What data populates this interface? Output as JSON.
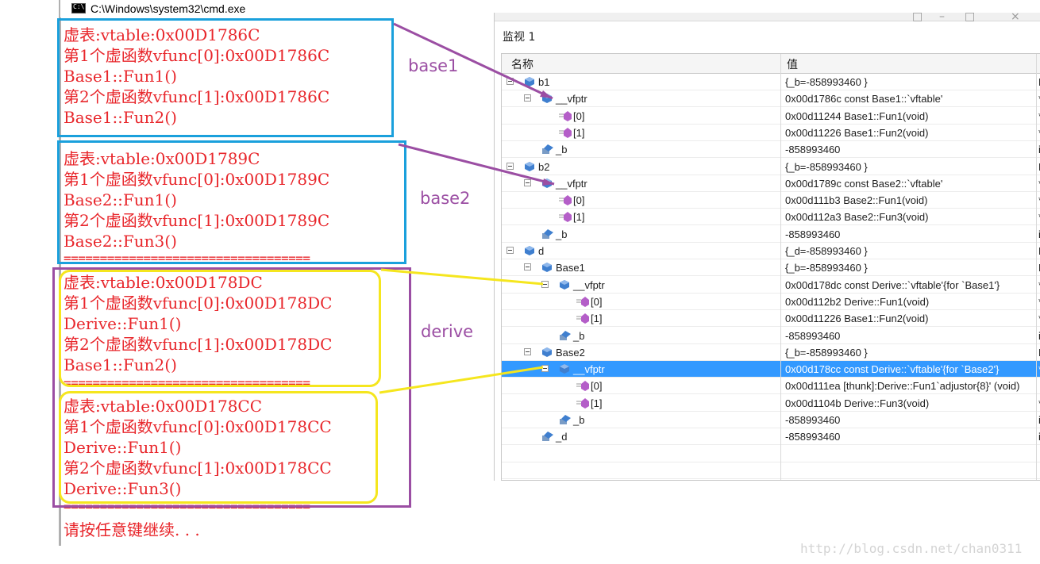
{
  "cmd": {
    "title": "C:\\Windows\\system32\\cmd.exe",
    "lines": [
      "虚表:vtable:0x00D1786C",
      "第1个虚函数vfunc[0]:0x00D1786C",
      "Base1::Fun1()",
      "第2个虚函数vfunc[1]:0x00D1786C",
      "Base1::Fun2()",
      "虚表:vtable:0x00D1789C",
      "第1个虚函数vfunc[0]:0x00D1789C",
      "Base2::Fun1()",
      "第2个虚函数vfunc[1]:0x00D1789C",
      "Base2::Fun3()",
      "虚表:vtable:0x00D178DC",
      "第1个虚函数vfunc[0]:0x00D178DC",
      "Derive::Fun1()",
      "第2个虚函数vfunc[1]:0x00D178DC",
      "Base1::Fun2()",
      "虚表:vtable:0x00D178CC",
      "第1个虚函数vfunc[0]:0x00D178CC",
      "Derive::Fun1()",
      "第2个虚函数vfunc[1]:0x00D178CC",
      "Derive::Fun3()"
    ],
    "separator1": "==================================",
    "separator2": "==================================",
    "separator3": "==================================",
    "prompt": "请按任意键继续. . ."
  },
  "annotations": {
    "base1": "base1",
    "base2": "base2",
    "derive": "derive",
    "colors": {
      "blue": "#1aa0dc",
      "purple": "#9b4ea3",
      "yellow": "#f5e61e"
    }
  },
  "watch": {
    "title": "监视 1",
    "col_name": "名称",
    "col_value": "值",
    "rows": [
      {
        "name": "b1",
        "value": "{_b=-858993460 }",
        "type": "B",
        "icon": "object-icon"
      },
      {
        "name": "__vfptr",
        "value": "0x00d1786c const Base1::`vftable'",
        "type": "*",
        "icon": "object-icon"
      },
      {
        "name": "[0]",
        "value": "0x00d11244 Base1::Fun1(void)",
        "type": "*",
        "icon": "method-icon"
      },
      {
        "name": "[1]",
        "value": "0x00d11226 Base1::Fun2(void)",
        "type": "*",
        "icon": "method-icon"
      },
      {
        "name": "_b",
        "value": "-858993460",
        "type": "i",
        "icon": "field-icon"
      },
      {
        "name": "b2",
        "value": "{_b=-858993460 }",
        "type": "B",
        "icon": "object-icon"
      },
      {
        "name": "__vfptr",
        "value": "0x00d1789c const Base2::`vftable'",
        "type": "*",
        "icon": "object-icon"
      },
      {
        "name": "[0]",
        "value": "0x00d111b3 Base2::Fun1(void)",
        "type": "*",
        "icon": "method-icon"
      },
      {
        "name": "[1]",
        "value": "0x00d112a3 Base2::Fun3(void)",
        "type": "*",
        "icon": "method-icon"
      },
      {
        "name": "_b",
        "value": "-858993460",
        "type": "i",
        "icon": "field-icon"
      },
      {
        "name": "d",
        "value": "{_d=-858993460 }",
        "type": "D",
        "icon": "object-icon"
      },
      {
        "name": "Base1",
        "value": "{_b=-858993460 }",
        "type": "B",
        "icon": "object-icon"
      },
      {
        "name": "__vfptr",
        "value": "0x00d178dc const Derive::`vftable'{for `Base1'}",
        "type": "*",
        "icon": "object-icon"
      },
      {
        "name": "[0]",
        "value": "0x00d112b2 Derive::Fun1(void)",
        "type": "*",
        "icon": "method-icon"
      },
      {
        "name": "[1]",
        "value": "0x00d11226 Base1::Fun2(void)",
        "type": "*",
        "icon": "method-icon"
      },
      {
        "name": "_b",
        "value": "-858993460",
        "type": "i",
        "icon": "field-icon"
      },
      {
        "name": "Base2",
        "value": "{_b=-858993460 }",
        "type": "B",
        "icon": "object-icon"
      },
      {
        "name": "__vfptr",
        "value": "0x00d178cc const Derive::`vftable'{for `Base2'}",
        "type": "*",
        "icon": "object-icon",
        "selected": true
      },
      {
        "name": "[0]",
        "value": "0x00d111ea [thunk]:Derive::Fun1`adjustor{8}' (void)",
        "type": "",
        "icon": "method-icon"
      },
      {
        "name": "[1]",
        "value": "0x00d1104b Derive::Fun3(void)",
        "type": "*",
        "icon": "method-icon"
      },
      {
        "name": "_b",
        "value": "-858993460",
        "type": "i",
        "icon": "field-icon"
      },
      {
        "name": "_d",
        "value": "-858993460",
        "type": "i",
        "icon": "field-icon"
      }
    ]
  },
  "watermark": "http://blog.csdn.net/chan0311"
}
